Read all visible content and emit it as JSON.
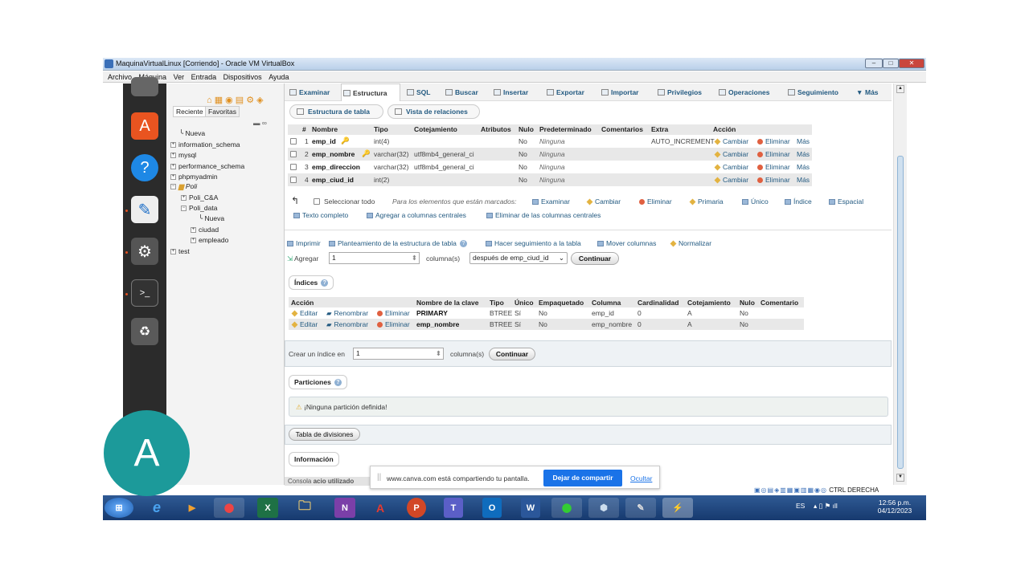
{
  "window": {
    "title": "MaquinaVirtualLinux [Corriendo] - Oracle VM VirtualBox"
  },
  "menu": [
    "Archivo",
    "Máquina",
    "Ver",
    "Entrada",
    "Dispositivos",
    "Ayuda"
  ],
  "nav": {
    "tabs": [
      "Reciente",
      "Favoritas"
    ],
    "tree": [
      "Nueva",
      "information_schema",
      "mysql",
      "performance_schema",
      "phpmyadmin",
      "Poli",
      "Poli_C&A",
      "Poli_data",
      "Nueva",
      "ciudad",
      "empleado",
      "test"
    ]
  },
  "top_tabs": [
    "Examinar",
    "Estructura",
    "SQL",
    "Buscar",
    "Insertar",
    "Exportar",
    "Importar",
    "Privilegios",
    "Operaciones",
    "Seguimiento",
    "Más"
  ],
  "sub_tabs": [
    "Estructura de tabla",
    "Vista de relaciones"
  ],
  "columns": {
    "headers": [
      "#",
      "Nombre",
      "Tipo",
      "Cotejamiento",
      "Atributos",
      "Nulo",
      "Predeterminado",
      "Comentarios",
      "Extra",
      "Acción"
    ],
    "rows": [
      {
        "num": "1",
        "name": "emp_id",
        "type": "int(4)",
        "collation": "",
        "null": "No",
        "default": "Ninguna",
        "extra": "AUTO_INCREMENT"
      },
      {
        "num": "2",
        "name": "emp_nombre",
        "type": "varchar(32)",
        "collation": "utf8mb4_general_ci",
        "null": "No",
        "default": "Ninguna",
        "extra": ""
      },
      {
        "num": "3",
        "name": "emp_direccion",
        "type": "varchar(32)",
        "collation": "utf8mb4_general_ci",
        "null": "No",
        "default": "Ninguna",
        "extra": ""
      },
      {
        "num": "4",
        "name": "emp_ciud_id",
        "type": "int(2)",
        "collation": "",
        "null": "No",
        "default": "Ninguna",
        "extra": ""
      }
    ],
    "actions": [
      "Cambiar",
      "Eliminar",
      "Más"
    ]
  },
  "bulk": {
    "select_all": "Seleccionar todo",
    "marked": "Para los elementos que están marcados:",
    "actions": [
      "Examinar",
      "Cambiar",
      "Eliminar",
      "Primaria",
      "Único",
      "Índice",
      "Espacial"
    ],
    "actions2": [
      "Texto completo",
      "Agregar a columnas centrales",
      "Eliminar de las columnas centrales"
    ]
  },
  "tools": [
    "Imprimir",
    "Planteamiento de la estructura de tabla",
    "Hacer seguimiento a la tabla",
    "Mover columnas",
    "Normalizar"
  ],
  "add": {
    "label": "Agregar",
    "value": "1",
    "suffix": "columna(s)",
    "position": "después de emp_ciud_id",
    "button": "Continuar"
  },
  "indexes": {
    "title": "Índices",
    "headers": [
      "Acción",
      "Nombre de la clave",
      "Tipo",
      "Único",
      "Empaquetado",
      "Columna",
      "Cardinalidad",
      "Cotejamiento",
      "Nulo",
      "Comentario"
    ],
    "rows": [
      {
        "key": "PRIMARY",
        "type": "BTREE",
        "unique": "Sí",
        "packed": "No",
        "column": "emp_id",
        "card": "0",
        "coll": "A",
        "null": "No"
      },
      {
        "key": "emp_nombre",
        "type": "BTREE",
        "unique": "Sí",
        "packed": "No",
        "column": "emp_nombre",
        "card": "0",
        "coll": "A",
        "null": "No"
      }
    ],
    "actions": [
      "Editar",
      "Renombrar",
      "Eliminar"
    ],
    "create_label": "Crear un índice en",
    "create_value": "1",
    "create_suffix": "columna(s)",
    "button": "Continuar"
  },
  "partitions": {
    "title": "Particiones",
    "notice": "¡Ninguna partición definida!",
    "button": "Tabla de divisiones"
  },
  "info": {
    "title": "Información",
    "console": "Consola",
    "partial": "acio utilizado"
  },
  "share": {
    "text": "www.canva.com está compartiendo tu pantalla.",
    "stop": "Dejar de compartir",
    "hide": "Ocultar"
  },
  "avatar": "A",
  "tray": {
    "lang": "ES",
    "time": "12:56 p.m.",
    "date": "04/12/2023",
    "host": "CTRL DERECHA"
  },
  "taskbar": [
    "e",
    "▶",
    "⬤",
    "X",
    "🗀",
    "N",
    "A",
    "P",
    "T",
    "O",
    "W",
    "⬤",
    "⬢",
    "✎",
    "⚡"
  ]
}
